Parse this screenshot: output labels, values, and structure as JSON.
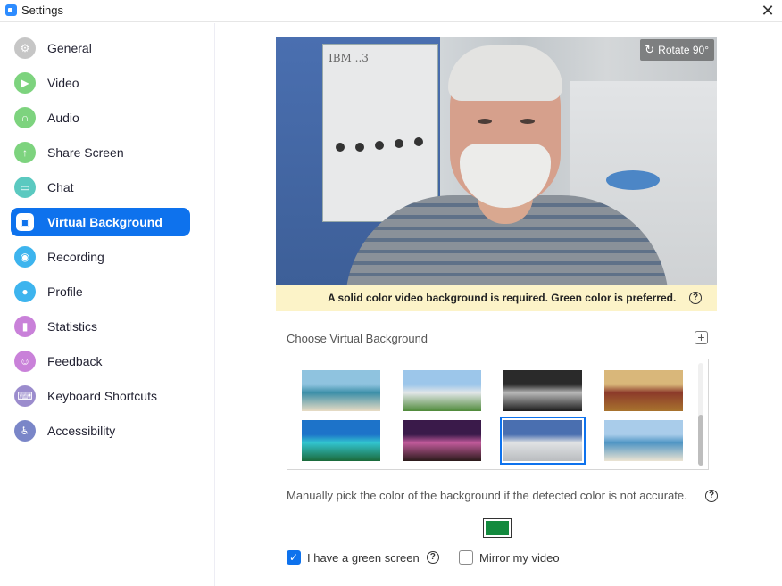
{
  "window": {
    "title": "Settings",
    "close_glyph": "✕"
  },
  "sidebar": {
    "items": [
      {
        "label": "General",
        "icon": "gear-icon",
        "color": "#c6c6c6",
        "glyph": "⚙"
      },
      {
        "label": "Video",
        "icon": "video-camera-icon",
        "color": "#7dd37e",
        "glyph": "▶"
      },
      {
        "label": "Audio",
        "icon": "headphones-icon",
        "color": "#7dd37e",
        "glyph": "∩"
      },
      {
        "label": "Share Screen",
        "icon": "share-screen-icon",
        "color": "#7dd37e",
        "glyph": "↑"
      },
      {
        "label": "Chat",
        "icon": "chat-bubble-icon",
        "color": "#5bc9c0",
        "glyph": "▭"
      },
      {
        "label": "Virtual Background",
        "icon": "virtual-background-icon",
        "color": "#ffffff",
        "glyph": "▣",
        "active": true
      },
      {
        "label": "Recording",
        "icon": "record-icon",
        "color": "#3db4ee",
        "glyph": "◉"
      },
      {
        "label": "Profile",
        "icon": "profile-icon",
        "color": "#3db4ee",
        "glyph": "●"
      },
      {
        "label": "Statistics",
        "icon": "statistics-icon",
        "color": "#c981d9",
        "glyph": "▮"
      },
      {
        "label": "Feedback",
        "icon": "feedback-icon",
        "color": "#c981d9",
        "glyph": "☺"
      },
      {
        "label": "Keyboard Shortcuts",
        "icon": "keyboard-icon",
        "color": "#9b8ccd",
        "glyph": "⌨"
      },
      {
        "label": "Accessibility",
        "icon": "accessibility-icon",
        "color": "#7a86c8",
        "glyph": "♿"
      }
    ]
  },
  "preview": {
    "rotate_label": "Rotate 90°",
    "rotate_glyph": "↻",
    "panel_label": "IBM ..3"
  },
  "warning": {
    "text": "A solid color video background is required. Green color is preferred.",
    "help_glyph": "?"
  },
  "backgrounds": {
    "title": "Choose Virtual Background",
    "add_glyph": "+",
    "thumbnails": [
      {
        "name": "beach-shore",
        "top": "#8fc3df",
        "mid": "#3c8fa8",
        "bottom": "#e8dcc4"
      },
      {
        "name": "lawn-building",
        "top": "#9cc6ea",
        "mid": "#e2e6e8",
        "bottom": "#4e8a3a"
      },
      {
        "name": "dark-classroom",
        "top": "#2a2a2a",
        "mid": "#b8b8b8",
        "bottom": "#1c1c1c"
      },
      {
        "name": "oval-office",
        "top": "#d9b77a",
        "mid": "#8c3a2a",
        "bottom": "#a8742e"
      },
      {
        "name": "tropical-lagoon",
        "top": "#1d73c9",
        "mid": "#32c4cf",
        "bottom": "#1b6a3a"
      },
      {
        "name": "band-stage",
        "top": "#3a1a4a",
        "mid": "#c05a9a",
        "bottom": "#2a1a1a"
      },
      {
        "name": "ibm-computer-room",
        "top": "#4a6fb0",
        "mid": "#e0e2e4",
        "bottom": "#b9bcbf",
        "selected": true
      },
      {
        "name": "crowded-beach",
        "top": "#a9ccea",
        "mid": "#4f95c4",
        "bottom": "#ece4d2"
      }
    ]
  },
  "color_pick": {
    "text": "Manually pick the color of the background if the detected color is not accurate.",
    "help_glyph": "?",
    "selected_color": "#138a3e"
  },
  "options": {
    "green_screen": {
      "label": "I have a green screen",
      "checked": true,
      "check_glyph": "✓",
      "help_glyph": "?"
    },
    "mirror": {
      "label": "Mirror my video",
      "checked": false
    }
  },
  "accent_color": "#0e72ed"
}
